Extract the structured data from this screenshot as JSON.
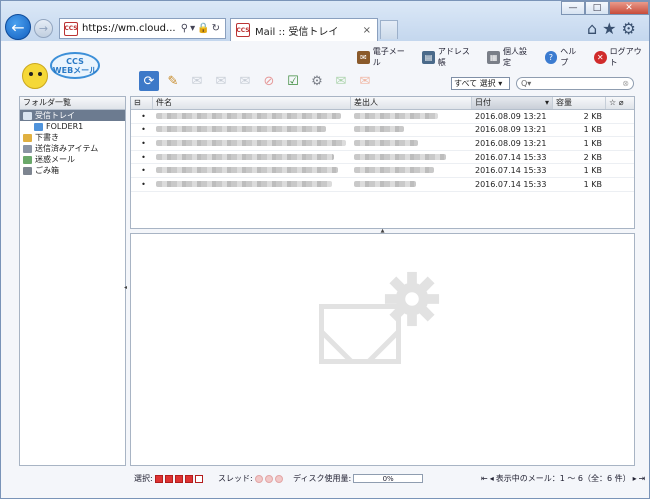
{
  "browser": {
    "url": "https://wm.cloud...",
    "tab_title": "Mail :: 受信トレイ",
    "tab_close": "×",
    "favicon_text": "CCS"
  },
  "logo": {
    "line1": "CCS",
    "line2": "WEBメール"
  },
  "top_menu": [
    {
      "label": "電子メール",
      "icon": "mail-icon",
      "color": "#8a5a2b"
    },
    {
      "label": "アドレス帳",
      "icon": "address-book-icon",
      "color": "#4a6a8a"
    },
    {
      "label": "個人設定",
      "icon": "user-settings-icon",
      "color": "#7a7f88"
    },
    {
      "label": "ヘルプ",
      "icon": "help-icon",
      "color": "#3b7bd0"
    },
    {
      "label": "ログアウト",
      "icon": "logout-icon",
      "color": "#d02b2b"
    }
  ],
  "toolbar": {
    "select_value": "すべて 選択",
    "search_placeholder": "Q▾"
  },
  "folders": {
    "header": "フォルダ一覧",
    "items": [
      {
        "label": "受信トレイ",
        "icon": "inbox-icon",
        "selected": true,
        "sub": false
      },
      {
        "label": "FOLDER1",
        "icon": "folder-icon",
        "selected": false,
        "sub": true
      },
      {
        "label": "下書き",
        "icon": "drafts-icon",
        "selected": false,
        "sub": false
      },
      {
        "label": "送信済みアイテム",
        "icon": "sent-icon",
        "selected": false,
        "sub": false
      },
      {
        "label": "迷惑メール",
        "icon": "junk-icon",
        "selected": false,
        "sub": false
      },
      {
        "label": "ごみ箱",
        "icon": "trash-icon",
        "selected": false,
        "sub": false
      }
    ]
  },
  "list": {
    "columns": {
      "subject": "件名",
      "from": "差出人",
      "date": "日付",
      "size": "容量"
    },
    "rows": [
      {
        "date": "2016.08.09 13:21",
        "size": "2 KB"
      },
      {
        "date": "2016.08.09 13:21",
        "size": "1 KB"
      },
      {
        "date": "2016.08.09 13:21",
        "size": "1 KB"
      },
      {
        "date": "2016.07.14 15:33",
        "size": "2 KB"
      },
      {
        "date": "2016.07.14 15:33",
        "size": "1 KB"
      },
      {
        "date": "2016.07.14 15:33",
        "size": "1 KB"
      }
    ]
  },
  "status": {
    "select_label": "選択:",
    "thread_label": "スレッド:",
    "disk_label": "ディスク使用量:",
    "disk_value": "0%",
    "count_text": "表示中のメール：1 ～ 6（全：6 件）"
  }
}
